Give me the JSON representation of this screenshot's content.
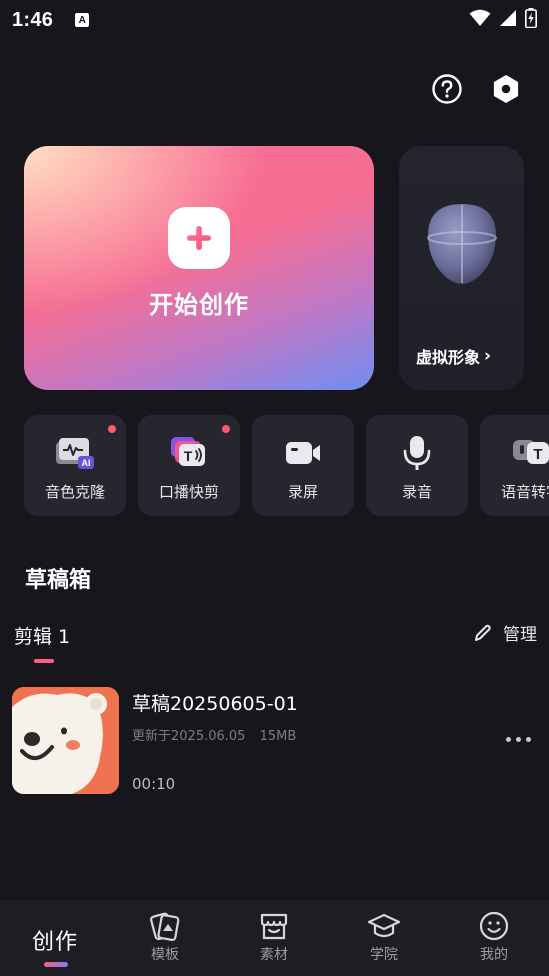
{
  "status_bar": {
    "time": "1:46",
    "notification_letter": "A"
  },
  "header": {
    "help_icon": "help-circle-icon",
    "settings_icon": "hexagon-settings-icon"
  },
  "create_card": {
    "label": "开始创作",
    "icon": "plus-icon"
  },
  "avatar_card": {
    "label": "虚拟形象",
    "chevron": "›"
  },
  "tools": [
    {
      "label": "音色克隆",
      "icon": "voice-clone-icon",
      "dot": true
    },
    {
      "label": "口播快剪",
      "icon": "speech-edit-icon",
      "dot": true
    },
    {
      "label": "录屏",
      "icon": "camera-icon",
      "dot": false
    },
    {
      "label": "录音",
      "icon": "microphone-icon",
      "dot": false
    },
    {
      "label": "语音转字",
      "icon": "speech-to-text-icon",
      "dot": false
    }
  ],
  "drafts": {
    "section_title": "草稿箱",
    "tab_label": "剪辑 1",
    "manage_label": "管理",
    "items": [
      {
        "title": "草稿20250605-01",
        "updated": "更新于2025.06.05",
        "size": "15MB",
        "duration": "00:10"
      }
    ]
  },
  "nav": {
    "active": "创作",
    "items": [
      {
        "label": "模板",
        "icon": "template-cards-icon"
      },
      {
        "label": "素材",
        "icon": "store-icon"
      },
      {
        "label": "学院",
        "icon": "graduation-cap-icon"
      },
      {
        "label": "我的",
        "icon": "smiley-icon"
      }
    ]
  },
  "colors": {
    "background": "#16161c",
    "accent_pink": "#ff5d85",
    "accent_purple": "#7b7cf5",
    "badge_red": "#ff5b6b"
  }
}
